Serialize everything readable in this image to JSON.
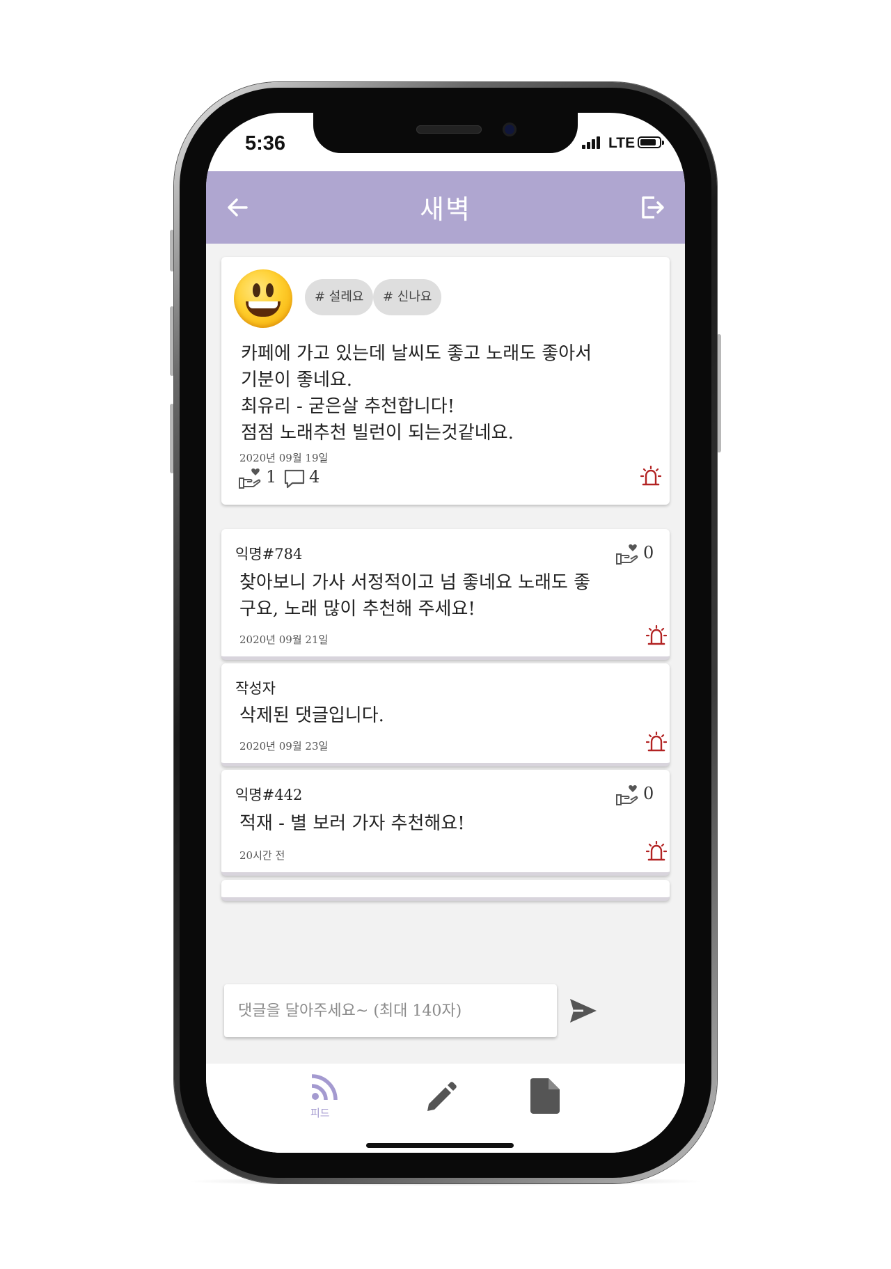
{
  "status_bar": {
    "time": "5:36",
    "network": "LTE"
  },
  "header": {
    "title": "새벽"
  },
  "colors": {
    "accent": "#afa6d0",
    "alert": "#b22222",
    "nav_active": "#a49ad0"
  },
  "post": {
    "emoji": "smiling-face-emoji",
    "tags": [
      "# 설레요",
      "# 신나요"
    ],
    "lines": [
      "카페에 가고 있는데 날씨도 좋고 노래도 좋아서",
      "기분이 좋네요.",
      "최유리 - 굳은살 추천합니다!",
      "점점 노래추천 빌런이 되는것같네요."
    ],
    "date": "2020년 09월 19일",
    "likes": "1",
    "comments": "4"
  },
  "comments": [
    {
      "author": "익명#784",
      "likes": "0",
      "lines": [
        "찾아보니 가사 서정적이고 넘 좋네요 노래도 좋",
        "구요, 노래 많이 추천해 주세요!"
      ],
      "date": "2020년 09월 21일"
    },
    {
      "author": "작성자",
      "lines": [
        "삭제된 댓글입니다."
      ],
      "date": "2020년 09월 23일"
    },
    {
      "author": "익명#442",
      "likes": "0",
      "lines": [
        "적재 - 별 보러 가자 추천해요!"
      ],
      "date": "20시간 전"
    }
  ],
  "comment_input": {
    "placeholder": "댓글을 달아주세요~ (최대 140자)",
    "value": ""
  },
  "nav": {
    "feed_label": "피드"
  }
}
